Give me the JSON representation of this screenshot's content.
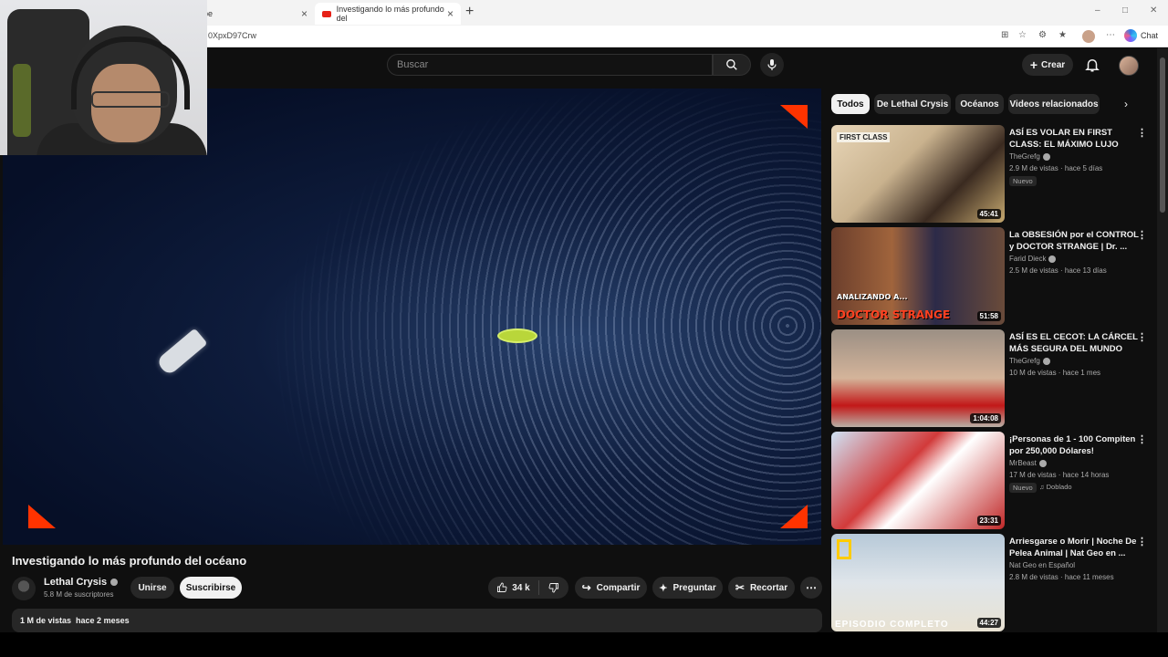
{
  "browser": {
    "tabs": [
      {
        "label": "ube"
      },
      {
        "label": "Investigando lo más profundo del"
      }
    ],
    "url": "0XpxD97Crw",
    "chat_label": "Chat"
  },
  "header": {
    "search_placeholder": "Buscar",
    "create_label": "Crear"
  },
  "video": {
    "title": "Investigando lo más profundo del océano",
    "channel": "Lethal Crysis",
    "subscribers": "5.8 M de suscriptores",
    "join_label": "Unirse",
    "subscribe_label": "Suscribirse",
    "likes": "34 k",
    "share_label": "Compartir",
    "ask_label": "Preguntar",
    "clip_label": "Recortar",
    "views": "1 M de vistas",
    "age": "hace 2 meses"
  },
  "chips": [
    "Todos",
    "De Lethal Crysis",
    "Océanos",
    "Videos relacionados"
  ],
  "related": [
    {
      "title": "ASÍ ES VOLAR EN FIRST CLASS: EL MÁXIMO LUJO",
      "channel": "TheGrefg",
      "meta": "2.9 M de vistas · hace 5 días",
      "badge": "Nuevo",
      "duration": "45:41",
      "thumb_text": "FIRST CLASS"
    },
    {
      "title": "La OBSESIÓN por el CONTROL y DOCTOR STRANGE | Dr. ...",
      "channel": "Farid Dieck",
      "meta": "2.5 M de vistas · hace 13 días",
      "duration": "51:58",
      "thumb_text": "DOCTOR STRANGE",
      "thumb_text_small": "ANALIZANDO A..."
    },
    {
      "title": "ASÍ ES EL CECOT: LA CÁRCEL MÁS SEGURA DEL MUNDO",
      "channel": "TheGrefg",
      "meta": "10 M de vistas · hace 1 mes",
      "duration": "1:04:08"
    },
    {
      "title": "¡Personas de 1 - 100 Compiten por 250,000 Dólares!",
      "channel": "MrBeast",
      "meta": "17 M de vistas · hace 14 horas",
      "badge": "Nuevo",
      "badge2": "Doblado",
      "duration": "23:31"
    },
    {
      "title": "Arriesgarse o Morir | Noche De Pelea Animal | Nat Geo en ...",
      "channel": "Nat Geo en Español",
      "meta": "2.8 M de vistas · hace 11 meses",
      "duration": "44:27",
      "thumb_text": "EPISODIO COMPLETO"
    }
  ]
}
